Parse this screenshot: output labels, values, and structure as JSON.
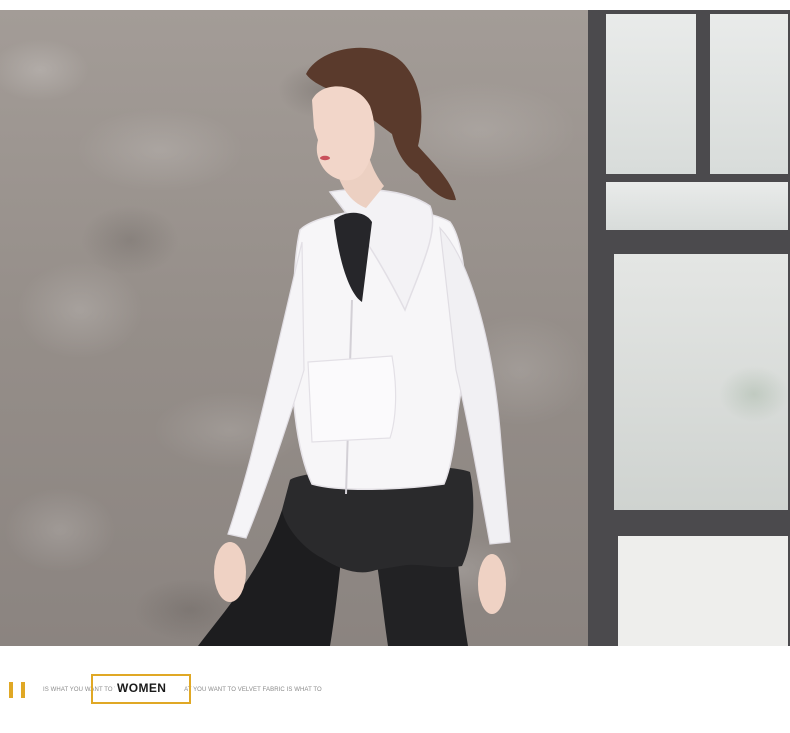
{
  "photo": {
    "subject": "woman-in-white-mesh-hooded-jacket",
    "colors": {
      "wall": "#958e89",
      "window_frame": "#4b4a4d",
      "jacket": "#f7f6f8",
      "pants": "#1f1f21",
      "hair": "#5a3a2c",
      "skin": "#efd2c4"
    }
  },
  "caption": {
    "accent_color": "#e0a825",
    "tagline_part1": "IS WHAT YOU WANT TO VEL",
    "tagline_part2": "AT YOU WANT TO VELVET FABRIC IS WHAT TO",
    "title": "WOMEN"
  }
}
